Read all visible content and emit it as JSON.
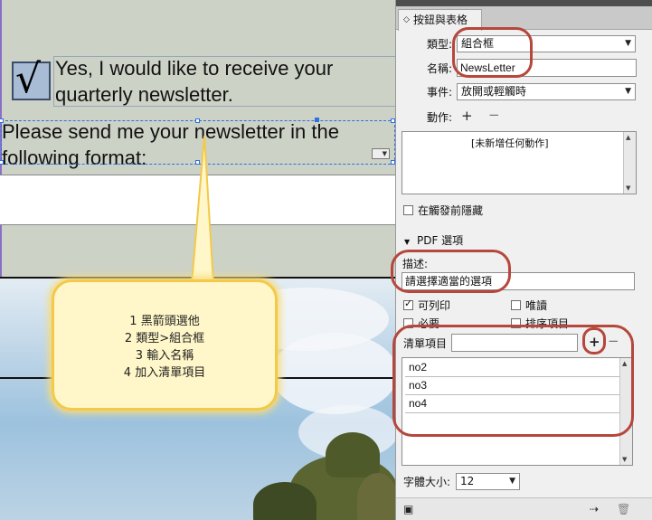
{
  "document": {
    "checkbox_text_line1": "Yes, I would like to receive your",
    "checkbox_text_line2": "quarterly newsletter.",
    "format_text_line1": "Please send me your newsletter in the",
    "format_text_line2": "following format:",
    "check_glyph": "√"
  },
  "callout": {
    "lines": [
      "1 黑箭頭選他",
      "2 類型>組合框",
      "3 輸入名稱",
      "4 加入清單項目"
    ]
  },
  "panel": {
    "tab_title": "按鈕與表格",
    "type_label": "類型:",
    "type_value": "組合框",
    "name_label": "名稱:",
    "name_value": "NewsLetter",
    "event_label": "事件:",
    "event_value": "放開或輕觸時",
    "action_label": "動作:",
    "action_empty": "[未新增任何動作]",
    "hide_until_triggered": "在觸發前隱藏",
    "pdf_options_heading": "PDF 選項",
    "description_label": "描述:",
    "description_value": "請選擇適當的選項",
    "printable_label": "可列印",
    "readonly_label": "唯讀",
    "required_label": "必要",
    "sort_items_label": "排序項目",
    "list_items_label": "清單項目",
    "list_item_value": "",
    "list_items": [
      "no2",
      "no3",
      "no4"
    ],
    "font_size_label": "字體大小:",
    "font_size_value": "12",
    "printable_checked": true,
    "readonly_checked": false,
    "required_checked": false,
    "sort_checked": false,
    "hide_checked": false
  },
  "colors": {
    "annotation_red": "#b5473d",
    "selection_blue": "#2f6fe0",
    "callout_fill": "#fff7c9",
    "callout_border": "#f3c94a"
  }
}
